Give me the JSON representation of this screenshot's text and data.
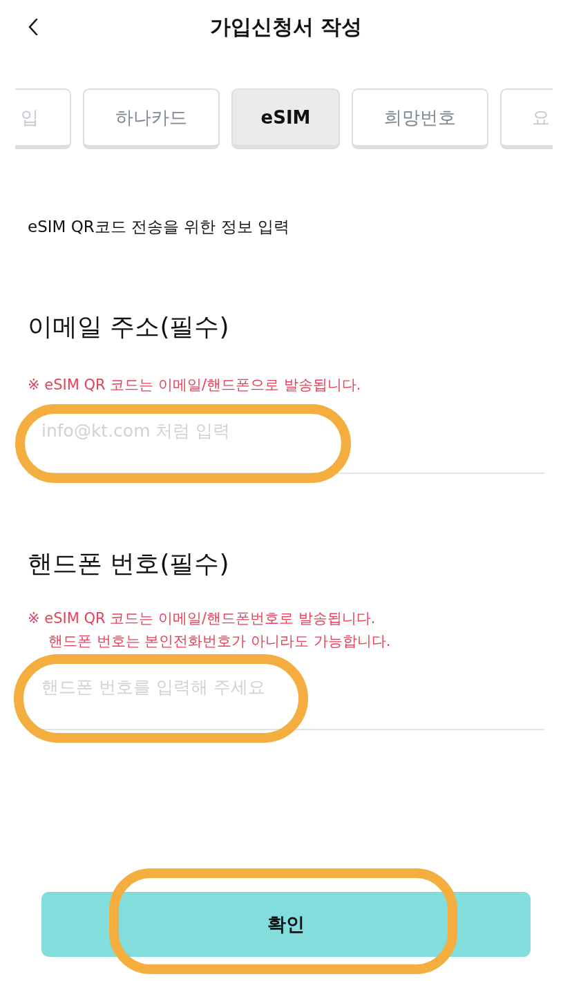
{
  "header": {
    "title": "가입신청서 작성"
  },
  "tabs": [
    {
      "label": "입",
      "selected": false
    },
    {
      "label": "하나카드",
      "selected": false
    },
    {
      "label": "eSIM",
      "selected": true
    },
    {
      "label": "희망번호",
      "selected": false
    },
    {
      "label": "요",
      "selected": false
    }
  ],
  "intro": "eSIM QR코드 전송을 위한 정보 입력",
  "sections": [
    {
      "title": "이메일 주소(필수)",
      "notes": [
        "※ eSIM QR 코드는 이메일/핸드폰으로 발송됩니다."
      ],
      "field": {
        "kind": "email",
        "placeholder": "info@kt.com 처럼 입력",
        "highlighted": true
      }
    },
    {
      "title": "핸드폰 번호(필수)",
      "notes": [
        "※ eSIM QR 코드는 이메일/핸드폰번호로 발송됩니다.",
        "핸드폰 번호는 본인전화번호가 아니라도 가능합니다."
      ],
      "field": {
        "kind": "phone",
        "placeholder": "핸드폰 번호를 입력해 주세요",
        "highlighted": true
      }
    }
  ],
  "confirm_button": {
    "label": "확인",
    "highlighted": true
  }
}
